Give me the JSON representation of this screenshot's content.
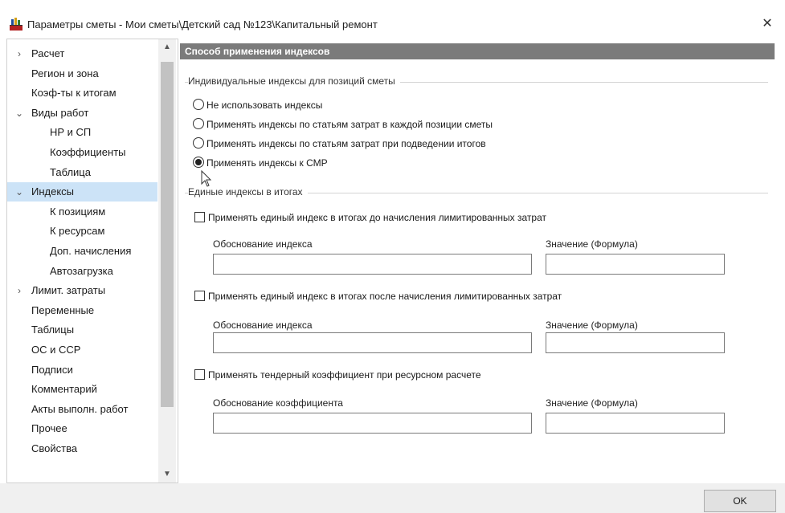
{
  "window": {
    "title": "Параметры сметы - Мои сметы\\Детский сад №123\\Капитальный ремонт",
    "close_label": "✕"
  },
  "sidebar": {
    "items": [
      {
        "label": "Расчет",
        "chevron": "›",
        "level": 0
      },
      {
        "label": "Регион и зона",
        "chevron": "",
        "level": 0
      },
      {
        "label": "Коэф-ты к итогам",
        "chevron": "",
        "level": 0
      },
      {
        "label": "Виды работ",
        "chevron": "⌄",
        "level": 0
      },
      {
        "label": "НР и СП",
        "chevron": "",
        "level": 1
      },
      {
        "label": "Коэффициенты",
        "chevron": "",
        "level": 1
      },
      {
        "label": "Таблица",
        "chevron": "",
        "level": 1
      },
      {
        "label": "Индексы",
        "chevron": "⌄",
        "level": 0,
        "selected": true
      },
      {
        "label": "К позициям",
        "chevron": "",
        "level": 1
      },
      {
        "label": "К ресурсам",
        "chevron": "",
        "level": 1
      },
      {
        "label": "Доп. начисления",
        "chevron": "",
        "level": 1
      },
      {
        "label": "Автозагрузка",
        "chevron": "",
        "level": 1
      },
      {
        "label": "Лимит. затраты",
        "chevron": "›",
        "level": 0
      },
      {
        "label": "Переменные",
        "chevron": "",
        "level": 0
      },
      {
        "label": "Таблицы",
        "chevron": "",
        "level": 0
      },
      {
        "label": "ОС и ССР",
        "chevron": "",
        "level": 0
      },
      {
        "label": "Подписи",
        "chevron": "",
        "level": 0
      },
      {
        "label": "Комментарий",
        "chevron": "",
        "level": 0
      },
      {
        "label": "Акты выполн. работ",
        "chevron": "",
        "level": 0
      },
      {
        "label": "Прочее",
        "chevron": "",
        "level": 0
      },
      {
        "label": "Свойства",
        "chevron": "",
        "level": 0
      }
    ],
    "scroll_up": "▲",
    "scroll_down": "▼"
  },
  "main": {
    "header": "Способ применения индексов",
    "group1_title": "Индивидуальные индексы для позиций сметы",
    "radios": [
      {
        "label": "Не использовать индексы",
        "checked": false
      },
      {
        "label": "Применять индексы по статьям затрат в каждой позиции сметы",
        "checked": false
      },
      {
        "label": "Применять индексы по статьям затрат при подведении итогов",
        "checked": false
      },
      {
        "label": "Применять индексы к СМР",
        "checked": true
      }
    ],
    "group2_title": "Единые индексы в итогах",
    "blocks": [
      {
        "checkbox_label": "Применять единый индекс в итогах до начисления лимитированных затрат",
        "left_label": "Обоснование индекса",
        "right_label": "Значение (Формула)",
        "left_value": "",
        "right_value": ""
      },
      {
        "checkbox_label": "Применять единый индекс в итогах после начисления лимитированных затрат",
        "left_label": "Обоснование индекса",
        "right_label": "Значение (Формула)",
        "left_value": "",
        "right_value": ""
      },
      {
        "checkbox_label": "Применять тендерный коэффициент при ресурсном расчете",
        "left_label": "Обоснование коэффициента",
        "right_label": "Значение (Формула)",
        "left_value": "",
        "right_value": ""
      }
    ]
  },
  "footer": {
    "ok_label": "OK"
  },
  "colors": {
    "header_bg": "#7b7b7b",
    "selected_bg": "#cce3f7"
  }
}
